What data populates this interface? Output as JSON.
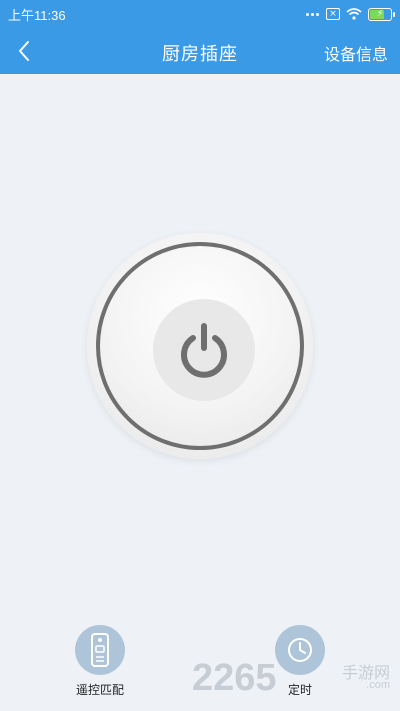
{
  "status_bar": {
    "time": "上午11:36",
    "icons": [
      "more-dots-icon",
      "notification-x-icon",
      "wifi-icon",
      "battery-charging-icon"
    ]
  },
  "navbar": {
    "title": "厨房插座",
    "right_action": "设备信息"
  },
  "power": {
    "icon": "power-icon"
  },
  "controls": {
    "remote_label": "遥控匹配",
    "timer_label": "定时"
  },
  "watermark": {
    "number": "2265",
    "brand": "手游网",
    "domain": ".com"
  },
  "colors": {
    "primary": "#3b9ae6",
    "background": "#eef2f7",
    "control_circle": "#aec4d8"
  }
}
